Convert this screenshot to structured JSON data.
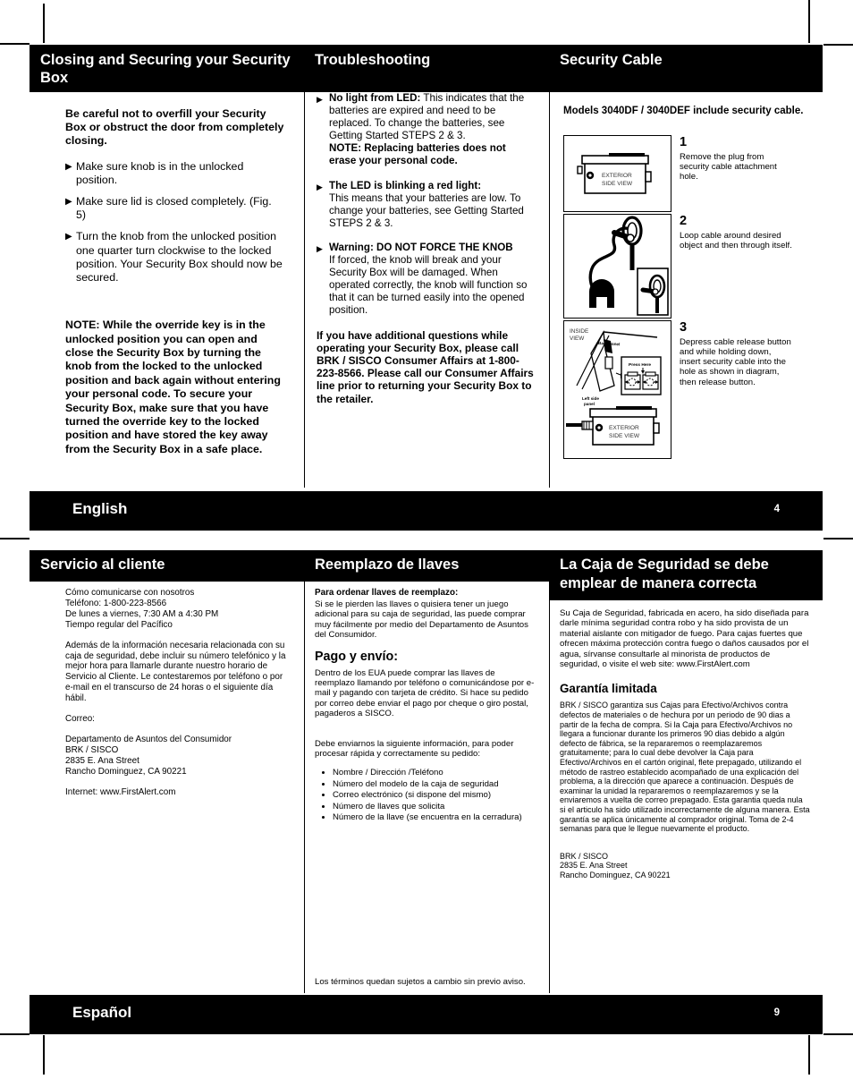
{
  "page_en": {
    "number": "4",
    "language": "English",
    "col1": {
      "header": "Closing and Securing your Security Box",
      "lead": "Be careful not to overfill your Security Box or obstruct the door from completely closing.",
      "bullets": [
        "Make sure knob is in the unlocked position.",
        "Make sure lid is closed completely. (Fig. 5)",
        "Turn the knob from the unlocked position one quarter turn clockwise to the locked position. Your Security Box should now be secured."
      ],
      "note": "NOTE: While the override key is in the unlocked position you can open and close the Security Box by turning the knob from the locked to the unlocked position and back again without entering your personal code. To secure your Security Box, make sure that you have turned the override key to the locked position and have stored the key away from the Security Box in a safe place."
    },
    "col2": {
      "header": "Troubleshooting",
      "items": [
        {
          "title": "No light from LED:",
          "body": " This indicates that the batteries are expired and need to be replaced. To change the batteries, see Getting Started STEPS 2 & 3.",
          "note_label": "NOTE",
          "note_body": ": Replacing batteries does not erase your personal code."
        },
        {
          "title": "The LED is blinking a red light:",
          "body": "This means that your batteries are low. To change your batteries, see Getting Started STEPS 2 & 3."
        },
        {
          "title": "Warning: DO NOT FORCE THE KNOB",
          "body": "If forced, the knob will break and your Security Box will be damaged. When operated correctly, the knob will function so that it can be turned easily into the opened position."
        }
      ],
      "closing": "If you have additional questions while operating your Security Box, please call BRK / SISCO Consumer Affairs at 1-800-223-8566. Please call our Consumer Affairs line prior to returning your Security Box to the retailer."
    },
    "col3": {
      "header": "Security Cable",
      "models": "Models 3040DF / 3040DEF include security cable.",
      "steps": [
        {
          "num": "1",
          "text": "Remove the plug from security cable attachment hole.",
          "fig_labels": [
            "EXTERIOR",
            "SIDE VIEW"
          ]
        },
        {
          "num": "2",
          "text": "Loop cable around desired object and then through itself.",
          "fig_labels": []
        },
        {
          "num": "3",
          "text": "Depress cable release button and while holding down, insert security cable into the hole as shown in diagram, then release button.",
          "fig_labels": [
            "INSIDE VIEW",
            "Back panel",
            "Press Here",
            "Left side panel",
            "EXTERIOR",
            "SIDE VIEW"
          ]
        }
      ]
    }
  },
  "page_es": {
    "number": "9",
    "language": "Español",
    "col1": {
      "header": "Servicio al cliente",
      "p1_lines": [
        "Cómo comunicarse con nosotros",
        "Teléfono: 1-800-223-8566",
        "De lunes a viernes, 7:30 AM a 4:30 PM",
        "Tiempo regular del Pacífico"
      ],
      "p2": "Además de la información necesaria relacionada con su caja de seguridad, debe incluir su número telefónico y la mejor hora para llamarle durante nuestro horario de Servicio al Cliente. Le contestaremos por teléfono o por e-mail en el transcurso de 24 horas o el siguiente día hábil.",
      "p3": "Correo:",
      "address_lines": [
        "Departamento de Asuntos del Consumidor",
        "BRK / SISCO",
        "2835 E. Ana Street",
        "Rancho Dominguez, CA 90221"
      ],
      "internet": "Internet: www.FirstAlert.com"
    },
    "col2": {
      "header": "Reemplazo de llaves",
      "sub1": "Para ordenar llaves de reemplazo:",
      "p1": "Si se le pierden las llaves o quisiera tener un juego adicional para su caja de seguridad, las puede comprar muy fácilmente por medio del Departamento de Asuntos del Consumidor.",
      "sub2": "Pago y envío:",
      "p2": "Dentro de los EUA puede comprar las llaves de reemplazo llamando por teléfono o comunicándose por e-mail y pagando con tarjeta de crédito. Si hace su pedido por correo debe enviar el pago por cheque o giro postal, pagaderos a SISCO.",
      "p3": "Debe enviarnos la siguiente información, para poder procesar rápida y correctamente su pedido:",
      "list": [
        "Nombre / Dirección /Teléfono",
        "Número del modelo de la caja de seguridad",
        "Correo electrónico (si dispone del mismo)",
        "Número de llaves que solicita",
        "Número de la llave (se encuentra en la cerradura)"
      ],
      "footer_note": "Los términos quedan sujetos a cambio sin previo aviso."
    },
    "col3": {
      "header": "La Caja de Seguridad se debe emplear de manera correcta",
      "p1": "Su Caja de Seguridad, fabricada en acero, ha sido diseñada para darle mínima seguridad contra robo y ha sido provista de un material aislante con mitigador de fuego. Para cajas fuertes que ofrecen máxima protección contra fuego o daños causados por el agua, sírvanse consultarle al minorista de productos de seguridad, o visite el web site: www.FirstAlert.com",
      "sub_warranty": "Garantía limitada",
      "warranty": "BRK / SISCO garantiza sus Cajas para Efectivo/Archivos contra defectos de materiales o de hechura por un periodo de 90 dias a partir de la fecha de compra. Si la Caja para Efectivo/Archivos no llegara a funcionar durante los primeros 90 dias debido a algún defecto de fábrica, se la repararemos o reemplazaremos gratuitamente; para lo cual debe devolver la Caja para Efectivo/Archivos en el cartón original, flete prepagado, utilizando el método de rastreo establecido acompañado de una explicación del problema, a la dirección que aparece a continuación. Después de examinar la unidad la repararemos o reemplazaremos y se la enviaremos a vuelta de correo prepagado. Esta garantia queda nula si el articulo ha sido utilizado incorrectamente de alguna manera. Esta garantía se aplica únicamente al comprador original. Toma de 2-4 semanas para que le llegue nuevamente el producto.",
      "address_lines": [
        "BRK / SISCO",
        "2835 E. Ana Street",
        "Rancho Dominguez, CA 90221"
      ]
    }
  },
  "icons": {
    "triangle": "▶",
    "bullet_dot": "•"
  }
}
